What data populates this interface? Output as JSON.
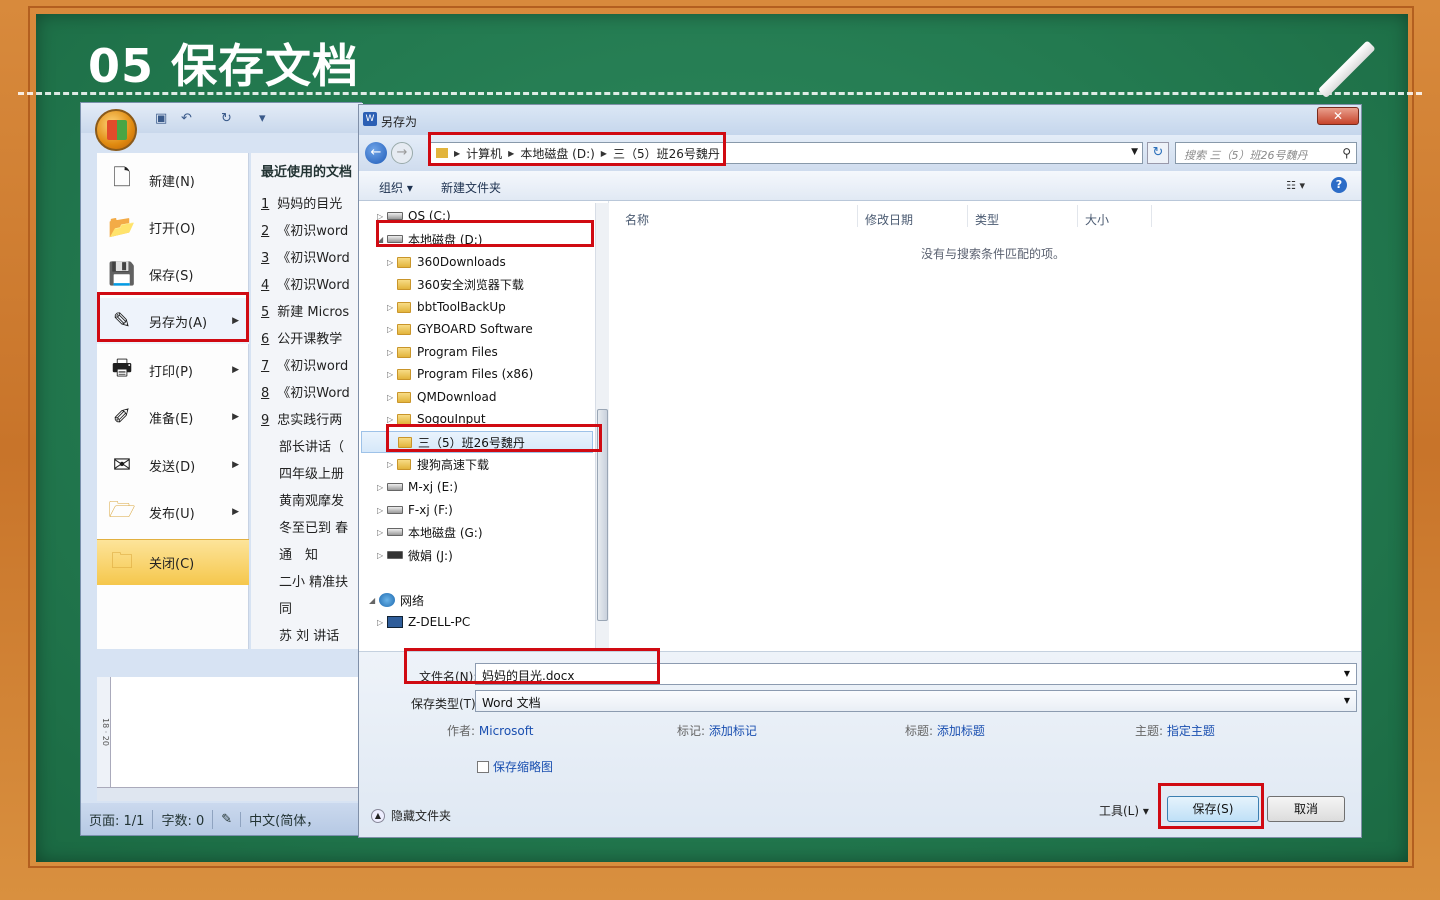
{
  "slide": {
    "title": "05 保存文档"
  },
  "word": {
    "menu": [
      {
        "label": "新建(N)",
        "icon": "new-document-icon"
      },
      {
        "label": "打开(O)",
        "icon": "open-folder-icon"
      },
      {
        "label": "保存(S)",
        "icon": "save-disk-icon"
      },
      {
        "label": "另存为(A)",
        "icon": "save-as-icon"
      },
      {
        "label": "打印(P)",
        "icon": "printer-icon"
      },
      {
        "label": "准备(E)",
        "icon": "prepare-icon"
      },
      {
        "label": "发送(D)",
        "icon": "send-icon"
      },
      {
        "label": "发布(U)",
        "icon": "publish-icon"
      },
      {
        "label": "关闭(C)",
        "icon": "close-folder-icon"
      }
    ],
    "recent_title": "最近使用的文档",
    "recent": [
      {
        "num": "1",
        "name": "妈妈的目光"
      },
      {
        "num": "2",
        "name": "《初识word"
      },
      {
        "num": "3",
        "name": "《初识Word"
      },
      {
        "num": "4",
        "name": "《初识Word"
      },
      {
        "num": "5",
        "name": "新建 Micros"
      },
      {
        "num": "6",
        "name": "公开课教学"
      },
      {
        "num": "7",
        "name": "《初识word"
      },
      {
        "num": "8",
        "name": "《初识Word"
      },
      {
        "num": "9",
        "name": "忠实践行两"
      },
      {
        "num": "",
        "name": "部长讲话（"
      },
      {
        "num": "",
        "name": "四年级上册"
      },
      {
        "num": "",
        "name": "黄南观摩发"
      },
      {
        "num": "",
        "name": "冬至已到 春"
      },
      {
        "num": "",
        "name": "通　知"
      },
      {
        "num": "",
        "name": "二小 精准扶"
      },
      {
        "num": "",
        "name": "同"
      },
      {
        "num": "",
        "name": "苏 刘 讲话"
      }
    ],
    "ruler": "18 · 20",
    "status": {
      "page": "页面: 1/1",
      "words": "字数: 0",
      "lang": "中文(简体，"
    }
  },
  "dialog": {
    "title": "另存为",
    "close": "✕",
    "address": [
      "计算机",
      "本地磁盘 (D:)",
      "三（5）班26号魏丹"
    ],
    "search_placeholder": "搜索 三（5）班26号魏丹",
    "toolbar": {
      "organize": "组织 ▾",
      "new_folder": "新建文件夹"
    },
    "tree": [
      {
        "label": "OS (C:)",
        "type": "drive",
        "level": 1
      },
      {
        "label": "本地磁盘 (D:)",
        "type": "drive",
        "level": 1
      },
      {
        "label": "360Downloads",
        "type": "folder",
        "level": 2
      },
      {
        "label": "360安全浏览器下载",
        "type": "folder",
        "level": 2
      },
      {
        "label": "bbtToolBackUp",
        "type": "folder",
        "level": 2
      },
      {
        "label": "GYBOARD Software",
        "type": "folder",
        "level": 2
      },
      {
        "label": "Program Files",
        "type": "folder",
        "level": 2
      },
      {
        "label": "Program Files (x86)",
        "type": "folder",
        "level": 2
      },
      {
        "label": "QMDownload",
        "type": "folder",
        "level": 2
      },
      {
        "label": "SogouInput",
        "type": "folder",
        "level": 2
      },
      {
        "label": "三（5）班26号魏丹",
        "type": "folder",
        "level": 2
      },
      {
        "label": "搜狗高速下载",
        "type": "folder",
        "level": 2
      },
      {
        "label": "M-xj (E:)",
        "type": "drive",
        "level": 1
      },
      {
        "label": "F-xj (F:)",
        "type": "drive",
        "level": 1
      },
      {
        "label": "本地磁盘 (G:)",
        "type": "drive",
        "level": 1
      },
      {
        "label": "微娟 (J:)",
        "type": "drive",
        "level": 1
      },
      {
        "label": "网络",
        "type": "network",
        "level": 0
      },
      {
        "label": "Z-DELL-PC",
        "type": "pc",
        "level": 1
      }
    ],
    "columns": [
      "名称",
      "修改日期",
      "类型",
      "大小"
    ],
    "empty_message": "没有与搜索条件匹配的项。",
    "filename_label": "文件名(N):",
    "filename": "妈妈的目光.docx",
    "filetype_label": "保存类型(T):",
    "filetype": "Word 文档",
    "meta": {
      "author_label": "作者:",
      "author": "Microsoft",
      "tags_label": "标记:",
      "tags": "添加标记",
      "title_label": "标题:",
      "title": "添加标题",
      "subject_label": "主题:",
      "subject": "指定主题"
    },
    "thumbnail": "保存缩略图",
    "hide_folders": "隐藏文件夹",
    "tools": "工具(L)",
    "save": "保存(S)",
    "cancel": "取消"
  },
  "colors": {
    "highlight": "#d00a12",
    "board": "#237a50",
    "frame": "#c8742a"
  }
}
